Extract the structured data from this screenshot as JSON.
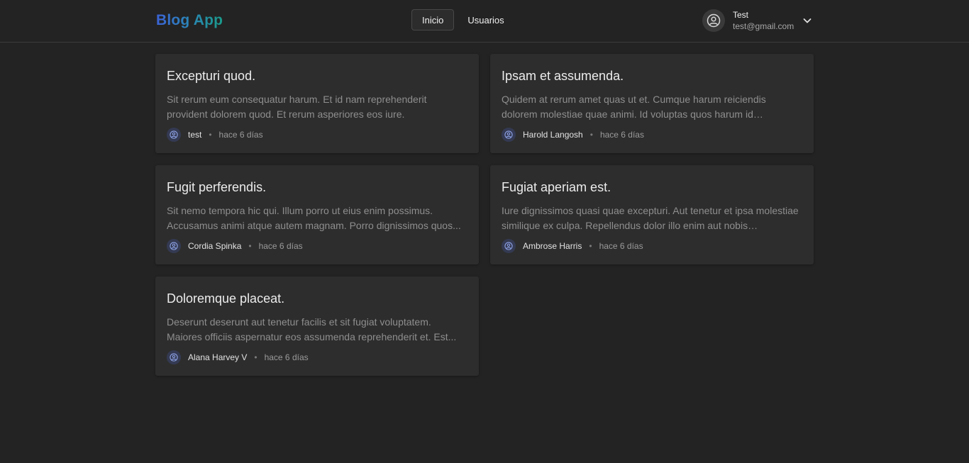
{
  "header": {
    "logo": "Blog App",
    "nav": [
      {
        "label": "Inicio",
        "active": true
      },
      {
        "label": "Usuarios",
        "active": false
      }
    ],
    "user": {
      "name": "Test",
      "email": "test@gmail.com",
      "icon": "user-circle-icon",
      "menu_icon": "chevron-down-icon"
    }
  },
  "posts": [
    {
      "title": "Excepturi quod.",
      "excerpt": "Sit rerum eum consequatur harum. Et id nam reprehenderit provident dolorem quod. Et rerum asperiores eos iure.",
      "author": "test",
      "time": "hace 6 días"
    },
    {
      "title": "Ipsam et assumenda.",
      "excerpt": "Quidem at rerum amet quas ut et. Cumque harum reiciendis dolorem molestiae quae animi. Id voluptas quos harum id inventore...",
      "author": "Harold Langosh",
      "time": "hace 6 días"
    },
    {
      "title": "Fugit perferendis.",
      "excerpt": "Sit nemo tempora hic qui. Illum porro ut eius enim possimus. Accusamus animi atque autem magnam. Porro dignissimos quos...",
      "author": "Cordia Spinka",
      "time": "hace 6 días"
    },
    {
      "title": "Fugiat aperiam est.",
      "excerpt": "Iure dignissimos quasi quae excepturi. Aut tenetur et ipsa molestiae similique ex culpa. Repellendus dolor illo enim aut nobis doloremqu...",
      "author": "Ambrose Harris",
      "time": "hace 6 días"
    },
    {
      "title": "Doloremque placeat.",
      "excerpt": "Deserunt deserunt aut tenetur facilis et sit fugiat voluptatem. Maiores officiis aspernatur eos assumenda reprehenderit et. Est...",
      "author": "Alana Harvey V",
      "time": "hace 6 días"
    }
  ],
  "meta_separator": "•",
  "colors": {
    "background": "#232323",
    "card": "#2d2d2d",
    "accent_blue": "#3b63d6",
    "accent_teal": "#1a9a8a"
  }
}
